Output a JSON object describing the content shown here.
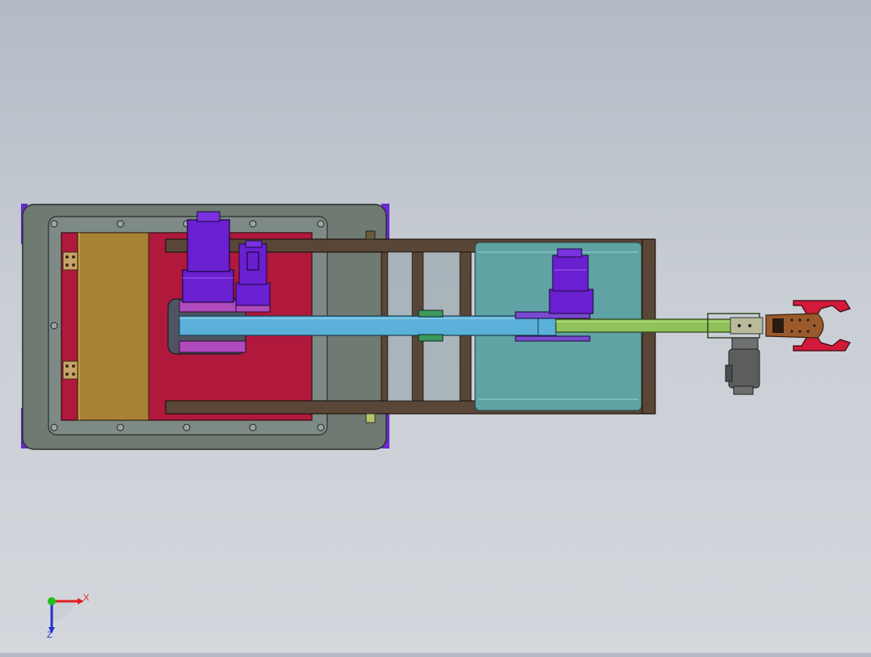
{
  "triad": {
    "x_label": "X",
    "z_label": "Z",
    "x_color": "#e02020",
    "y_color": "#20c020",
    "z_color": "#2030d0"
  },
  "colors": {
    "base_outer": "#6f7a72",
    "base_plate": "#7d8a86",
    "red_plate": "#b0183c",
    "gold_block": "#a68233",
    "frame_brown": "#5a4636",
    "teal_panel": "#5fa3a4",
    "motor_purple": "#6a1fd0",
    "coupling_magenta": "#b04bbf",
    "arm_blue": "#5ab0d8",
    "arm_green": "#8fc25a",
    "gripper_brown": "#9a5a2c",
    "gripper_red": "#d21a3a",
    "gray_motor": "#6d6f70"
  }
}
